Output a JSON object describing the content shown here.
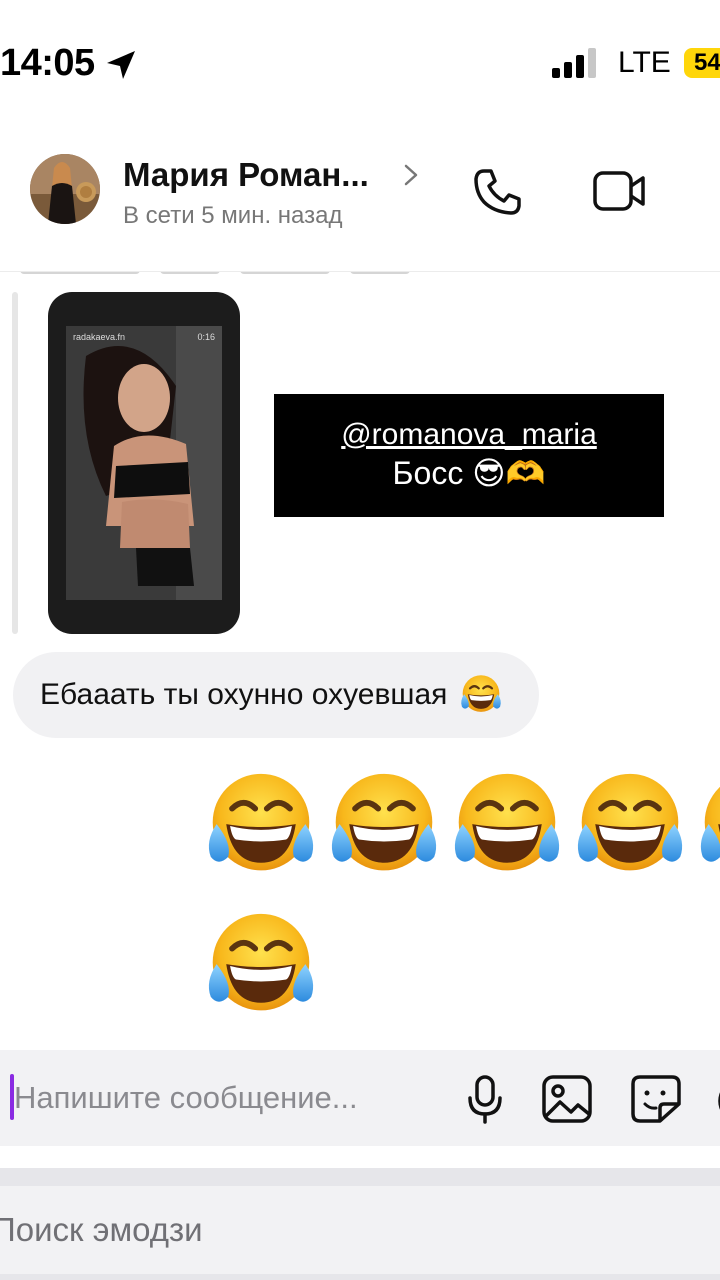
{
  "status_bar": {
    "time": "14:05",
    "network": "LTE",
    "battery": "54",
    "icons": [
      "location-arrow-icon",
      "signal-icon"
    ]
  },
  "header": {
    "contact_name": "Мария Роман...",
    "status": "В сети 5 мин. назад",
    "icons": [
      "chevron-right-icon",
      "phone-icon",
      "video-camera-icon"
    ]
  },
  "story_reply": {
    "story_username": "radakaeva.fn",
    "story_time": "0:16",
    "mention_handle": "@romanova_maria",
    "mention_text": "Босс 😎🫶"
  },
  "messages": [
    {
      "direction": "incoming",
      "text": "Ебааать ты охунно охуевшая",
      "emoji": "tears-of-joy-emoji"
    },
    {
      "direction": "outgoing",
      "text": "😂😂😂😂😂😂",
      "emoji_count": 6
    }
  ],
  "composer": {
    "placeholder": "Напишите сообщение...",
    "icons": [
      "microphone-icon",
      "image-gallery-icon",
      "sticker-icon"
    ]
  },
  "emoji_search": {
    "placeholder": "Поиск эмодзи"
  },
  "colors": {
    "battery": "#ffd60a",
    "caret": "#8a2be2",
    "bubble_incoming": "#f1f1f3",
    "mention_bg": "#000000"
  }
}
